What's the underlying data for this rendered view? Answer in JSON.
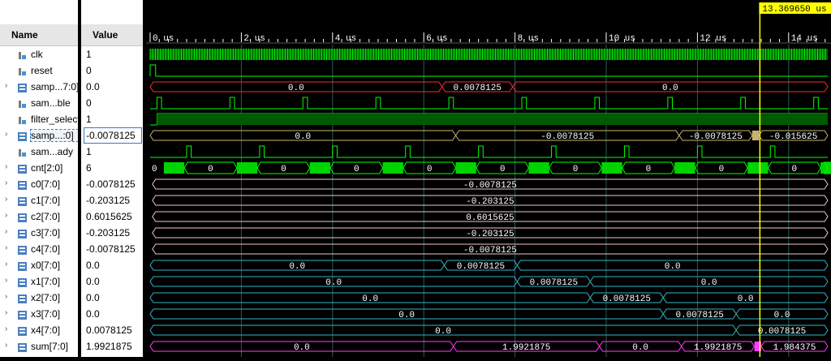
{
  "columns": {
    "name": "Name",
    "value": "Value"
  },
  "timeline": {
    "ticks": [
      "0 us",
      "2 us",
      "4 us",
      "6 us",
      "8 us",
      "10 us",
      "12 us",
      "14 us"
    ],
    "cursor_label": "13.369650 us"
  },
  "signals": [
    {
      "name": "clk",
      "value": "1",
      "expandable": false,
      "kind": "bit",
      "waveform": "clock"
    },
    {
      "name": "reset",
      "value": "0",
      "expandable": false,
      "kind": "bit",
      "waveform": "pulse-start"
    },
    {
      "name": "samp...7:0]",
      "value": "0.0",
      "expandable": true,
      "kind": "bus",
      "segments": [
        {
          "label": "0.0",
          "start": 0.0,
          "end": 6.4
        },
        {
          "label": "0.0078125",
          "start": 6.4,
          "end": 7.95
        },
        {
          "label": "0.0",
          "start": 7.95,
          "end": 15.0
        }
      ]
    },
    {
      "name": "sam...ble",
      "value": "0",
      "expandable": false,
      "kind": "bit",
      "waveform": "periodic-pulse"
    },
    {
      "name": "filter_select",
      "value": "1",
      "expandable": false,
      "kind": "bit",
      "waveform": "high"
    },
    {
      "name": "samp...:0]",
      "value": "-0.0078125",
      "expandable": true,
      "kind": "bus",
      "selected": true,
      "segments": [
        {
          "label": "0.0",
          "start": 0.0,
          "end": 6.7
        },
        {
          "label": "-0.0078125",
          "start": 6.7,
          "end": 11.6
        },
        {
          "label": "-0.0078125",
          "start": 11.6,
          "end": 13.2
        },
        {
          "label": "",
          "start": 13.2,
          "end": 13.35
        },
        {
          "label": "-0.015625",
          "start": 13.35,
          "end": 15.0
        }
      ]
    },
    {
      "name": "sam...ady",
      "value": "1",
      "expandable": false,
      "kind": "bit",
      "waveform": "periodic-pulse-offset"
    },
    {
      "name": "cnt[2:0]",
      "value": "6",
      "expandable": true,
      "kind": "counter"
    },
    {
      "name": "c0[7:0]",
      "value": "-0.0078125",
      "expandable": true,
      "kind": "bus",
      "segments": [
        {
          "label": "-0.0078125",
          "start": 0.05,
          "end": 15.0
        }
      ]
    },
    {
      "name": "c1[7:0]",
      "value": "-0.203125",
      "expandable": true,
      "kind": "bus",
      "segments": [
        {
          "label": "-0.203125",
          "start": 0.05,
          "end": 15.0
        }
      ]
    },
    {
      "name": "c2[7:0]",
      "value": "0.6015625",
      "expandable": true,
      "kind": "bus",
      "segments": [
        {
          "label": "0.6015625",
          "start": 0.05,
          "end": 15.0
        }
      ]
    },
    {
      "name": "c3[7:0]",
      "value": "-0.203125",
      "expandable": true,
      "kind": "bus",
      "segments": [
        {
          "label": "-0.203125",
          "start": 0.05,
          "end": 15.0
        }
      ]
    },
    {
      "name": "c4[7:0]",
      "value": "-0.0078125",
      "expandable": true,
      "kind": "bus",
      "segments": [
        {
          "label": "-0.0078125",
          "start": 0.05,
          "end": 15.0
        }
      ]
    },
    {
      "name": "x0[7:0]",
      "value": "0.0",
      "expandable": true,
      "kind": "bus",
      "segments": [
        {
          "label": "0.0",
          "start": 0.0,
          "end": 6.45
        },
        {
          "label": "0.0078125",
          "start": 6.45,
          "end": 8.05
        },
        {
          "label": "0.0",
          "start": 8.05,
          "end": 15.0
        }
      ]
    },
    {
      "name": "x1[7:0]",
      "value": "0.0",
      "expandable": true,
      "kind": "bus",
      "segments": [
        {
          "label": "0.0",
          "start": 0.0,
          "end": 8.05
        },
        {
          "label": "0.0078125",
          "start": 8.05,
          "end": 9.65
        },
        {
          "label": "0.0",
          "start": 9.65,
          "end": 15.0
        }
      ]
    },
    {
      "name": "x2[7:0]",
      "value": "0.0",
      "expandable": true,
      "kind": "bus",
      "segments": [
        {
          "label": "0.0",
          "start": 0.0,
          "end": 9.65
        },
        {
          "label": "0.0078125",
          "start": 9.65,
          "end": 11.25
        },
        {
          "label": "0.0",
          "start": 11.25,
          "end": 15.0
        }
      ]
    },
    {
      "name": "x3[7:0]",
      "value": "0.0",
      "expandable": true,
      "kind": "bus",
      "segments": [
        {
          "label": "0.0",
          "start": 0.0,
          "end": 11.25
        },
        {
          "label": "0.0078125",
          "start": 11.25,
          "end": 12.85
        },
        {
          "label": "0.0",
          "start": 12.85,
          "end": 15.0
        }
      ]
    },
    {
      "name": "x4[7:0]",
      "value": "0.0078125",
      "expandable": true,
      "kind": "bus",
      "segments": [
        {
          "label": "0.0",
          "start": 0.0,
          "end": 12.85
        },
        {
          "label": "0.0078125",
          "start": 12.85,
          "end": 15.0
        }
      ]
    },
    {
      "name": "sum[7:0]",
      "value": "1.9921875",
      "expandable": true,
      "kind": "bus",
      "segments": [
        {
          "label": "0.0",
          "start": 0.0,
          "end": 6.65
        },
        {
          "label": "1.9921875",
          "start": 6.65,
          "end": 9.85
        },
        {
          "label": "0.0",
          "start": 9.85,
          "end": 11.65
        },
        {
          "label": "1.9921875",
          "start": 11.65,
          "end": 13.25
        },
        {
          "label": "",
          "start": 13.25,
          "end": 13.4
        },
        {
          "label": "1.984375",
          "start": 13.4,
          "end": 15.0
        }
      ]
    }
  ],
  "counter_labels": [
    "0",
    "0",
    "0",
    "0",
    "0",
    "0",
    "0",
    "0",
    "0",
    "0"
  ],
  "colors": {
    "background": "#000000",
    "bit_wave": "#00ff00",
    "bus_red": "#ff2a2a",
    "bus_yellow": "#c8b46e",
    "bus_pink": "#f0c8c8",
    "bus_cyan": "#32b4c8",
    "bus_magenta": "#ff3cff",
    "cursor": "#ffff00",
    "timeline_text": "#ffffff",
    "grid": "#2a5a5a"
  },
  "cursor": {
    "time_us": 13.3697
  }
}
